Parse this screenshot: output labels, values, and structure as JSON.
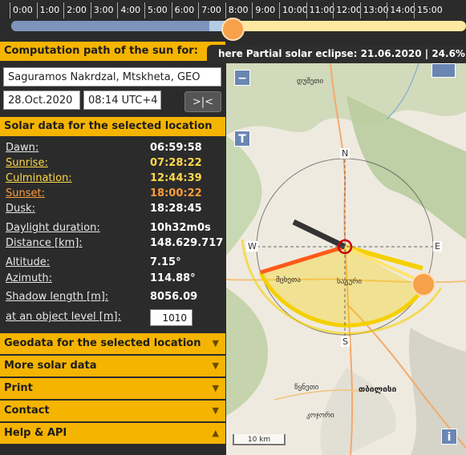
{
  "timeline": {
    "hours": [
      "0:00",
      "1:00",
      "2:00",
      "3:00",
      "4:00",
      "5:00",
      "6:00",
      "7:00",
      "8:00",
      "9:00",
      "10:00",
      "11:00",
      "12:00",
      "13:00",
      "14:00",
      "15:00"
    ],
    "current_time_fraction": 0.347
  },
  "eclipse_banner": "here Partial solar eclipse: 21.06.2020 | 24.6%",
  "computation": {
    "header": "Computation path of the sun for:",
    "location": "Saguramos Nakrdzal, Mtskheta, GEO",
    "date": "28.Oct.2020",
    "time": "08:14 UTC+4",
    "now_button": ">|<"
  },
  "solar": {
    "header": "Solar data for the selected location",
    "rows": [
      {
        "label": "Dawn:",
        "value": "06:59:58",
        "color": "white"
      },
      {
        "label": "Sunrise:",
        "value": "07:28:22",
        "color": "yellow"
      },
      {
        "label": "Culmination:",
        "value": "12:44:39",
        "color": "yellow"
      },
      {
        "label": "Sunset:",
        "value": "18:00:22",
        "color": "orange"
      },
      {
        "label": "Dusk:",
        "value": "18:28:45",
        "color": "white"
      }
    ],
    "daylight_label": "Daylight duration:",
    "daylight_value": "10h32m0s",
    "distance_label": "Distance [km]:",
    "distance_value": "148.629.717",
    "altitude_label": "Altitude:",
    "altitude_value": "7.15°",
    "azimuth_label": "Azimuth:",
    "azimuth_value": "114.88°",
    "shadow_label": "Shadow length [m]:",
    "shadow_value": "8056.09",
    "object_label": "at an object level [m]:",
    "object_value": "1010"
  },
  "accordion": [
    {
      "label": "Geodata for the selected location",
      "icon": "chevron-double-down-icon"
    },
    {
      "label": "More solar data",
      "icon": "chevron-double-down-icon"
    },
    {
      "label": "Print",
      "icon": "chevron-double-down-icon"
    },
    {
      "label": "Contact",
      "icon": "chevron-double-down-icon"
    },
    {
      "label": "Help & API",
      "icon": "chevron-double-up-icon"
    }
  ],
  "map": {
    "compass": {
      "n": "N",
      "s": "S",
      "e": "E",
      "w": "W"
    },
    "places": [
      "დუშეთი",
      "მცხეთა",
      "საგური",
      "წყნეთი",
      "თბილისი",
      "კოჯორი"
    ],
    "scale": "10 km",
    "zoom_minus": "−",
    "terrain_button": "T",
    "info_button": "i",
    "colors": {
      "daylight_arc": "#f5d000",
      "sunrise_line": "#ff8c1a",
      "sunset_line": "#ff5a1a",
      "shadow": "#333333",
      "sun": "#f7a14a"
    }
  }
}
